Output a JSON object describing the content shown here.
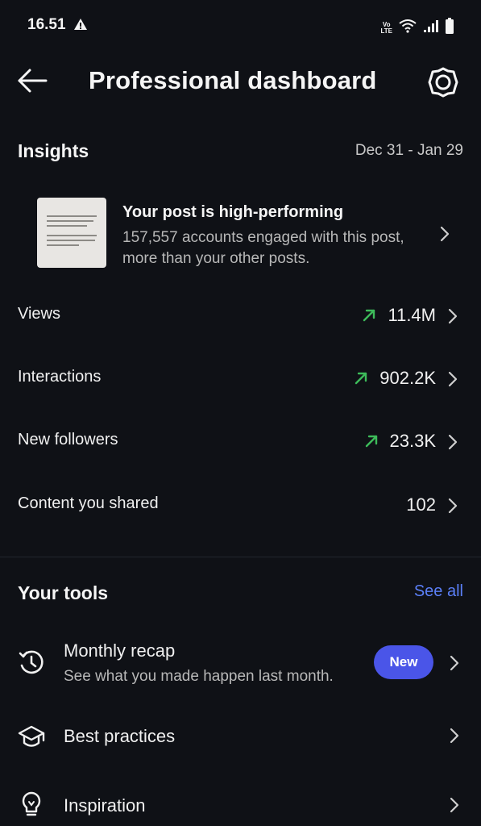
{
  "status_bar": {
    "time": "16.51",
    "volte_line1": "Vo",
    "volte_line2": "LTE"
  },
  "header": {
    "title": "Professional dashboard"
  },
  "insights": {
    "title": "Insights",
    "date_range": "Dec 31 - Jan 29",
    "post": {
      "title": "Your post is high-performing",
      "description": "157,557 accounts engaged with this post, more than your other posts."
    },
    "metrics": [
      {
        "label": "Views",
        "value": "11.4M",
        "trend": "up"
      },
      {
        "label": "Interactions",
        "value": "902.2K",
        "trend": "up"
      },
      {
        "label": "New followers",
        "value": "23.3K",
        "trend": "up"
      },
      {
        "label": "Content you shared",
        "value": "102",
        "trend": "none"
      }
    ]
  },
  "tools": {
    "title": "Your tools",
    "see_all": "See all",
    "items": [
      {
        "title": "Monthly recap",
        "subtitle": "See what you made happen last month.",
        "badge": "New",
        "icon": "recap-icon"
      },
      {
        "title": "Best practices",
        "icon": "graduation-cap-icon"
      },
      {
        "title": "Inspiration",
        "icon": "lightbulb-icon"
      }
    ]
  },
  "colors": {
    "background": "#0f1116",
    "accent": "#5b7ff7",
    "badge": "#4a55e8",
    "trend_up": "#3dbb5a"
  }
}
